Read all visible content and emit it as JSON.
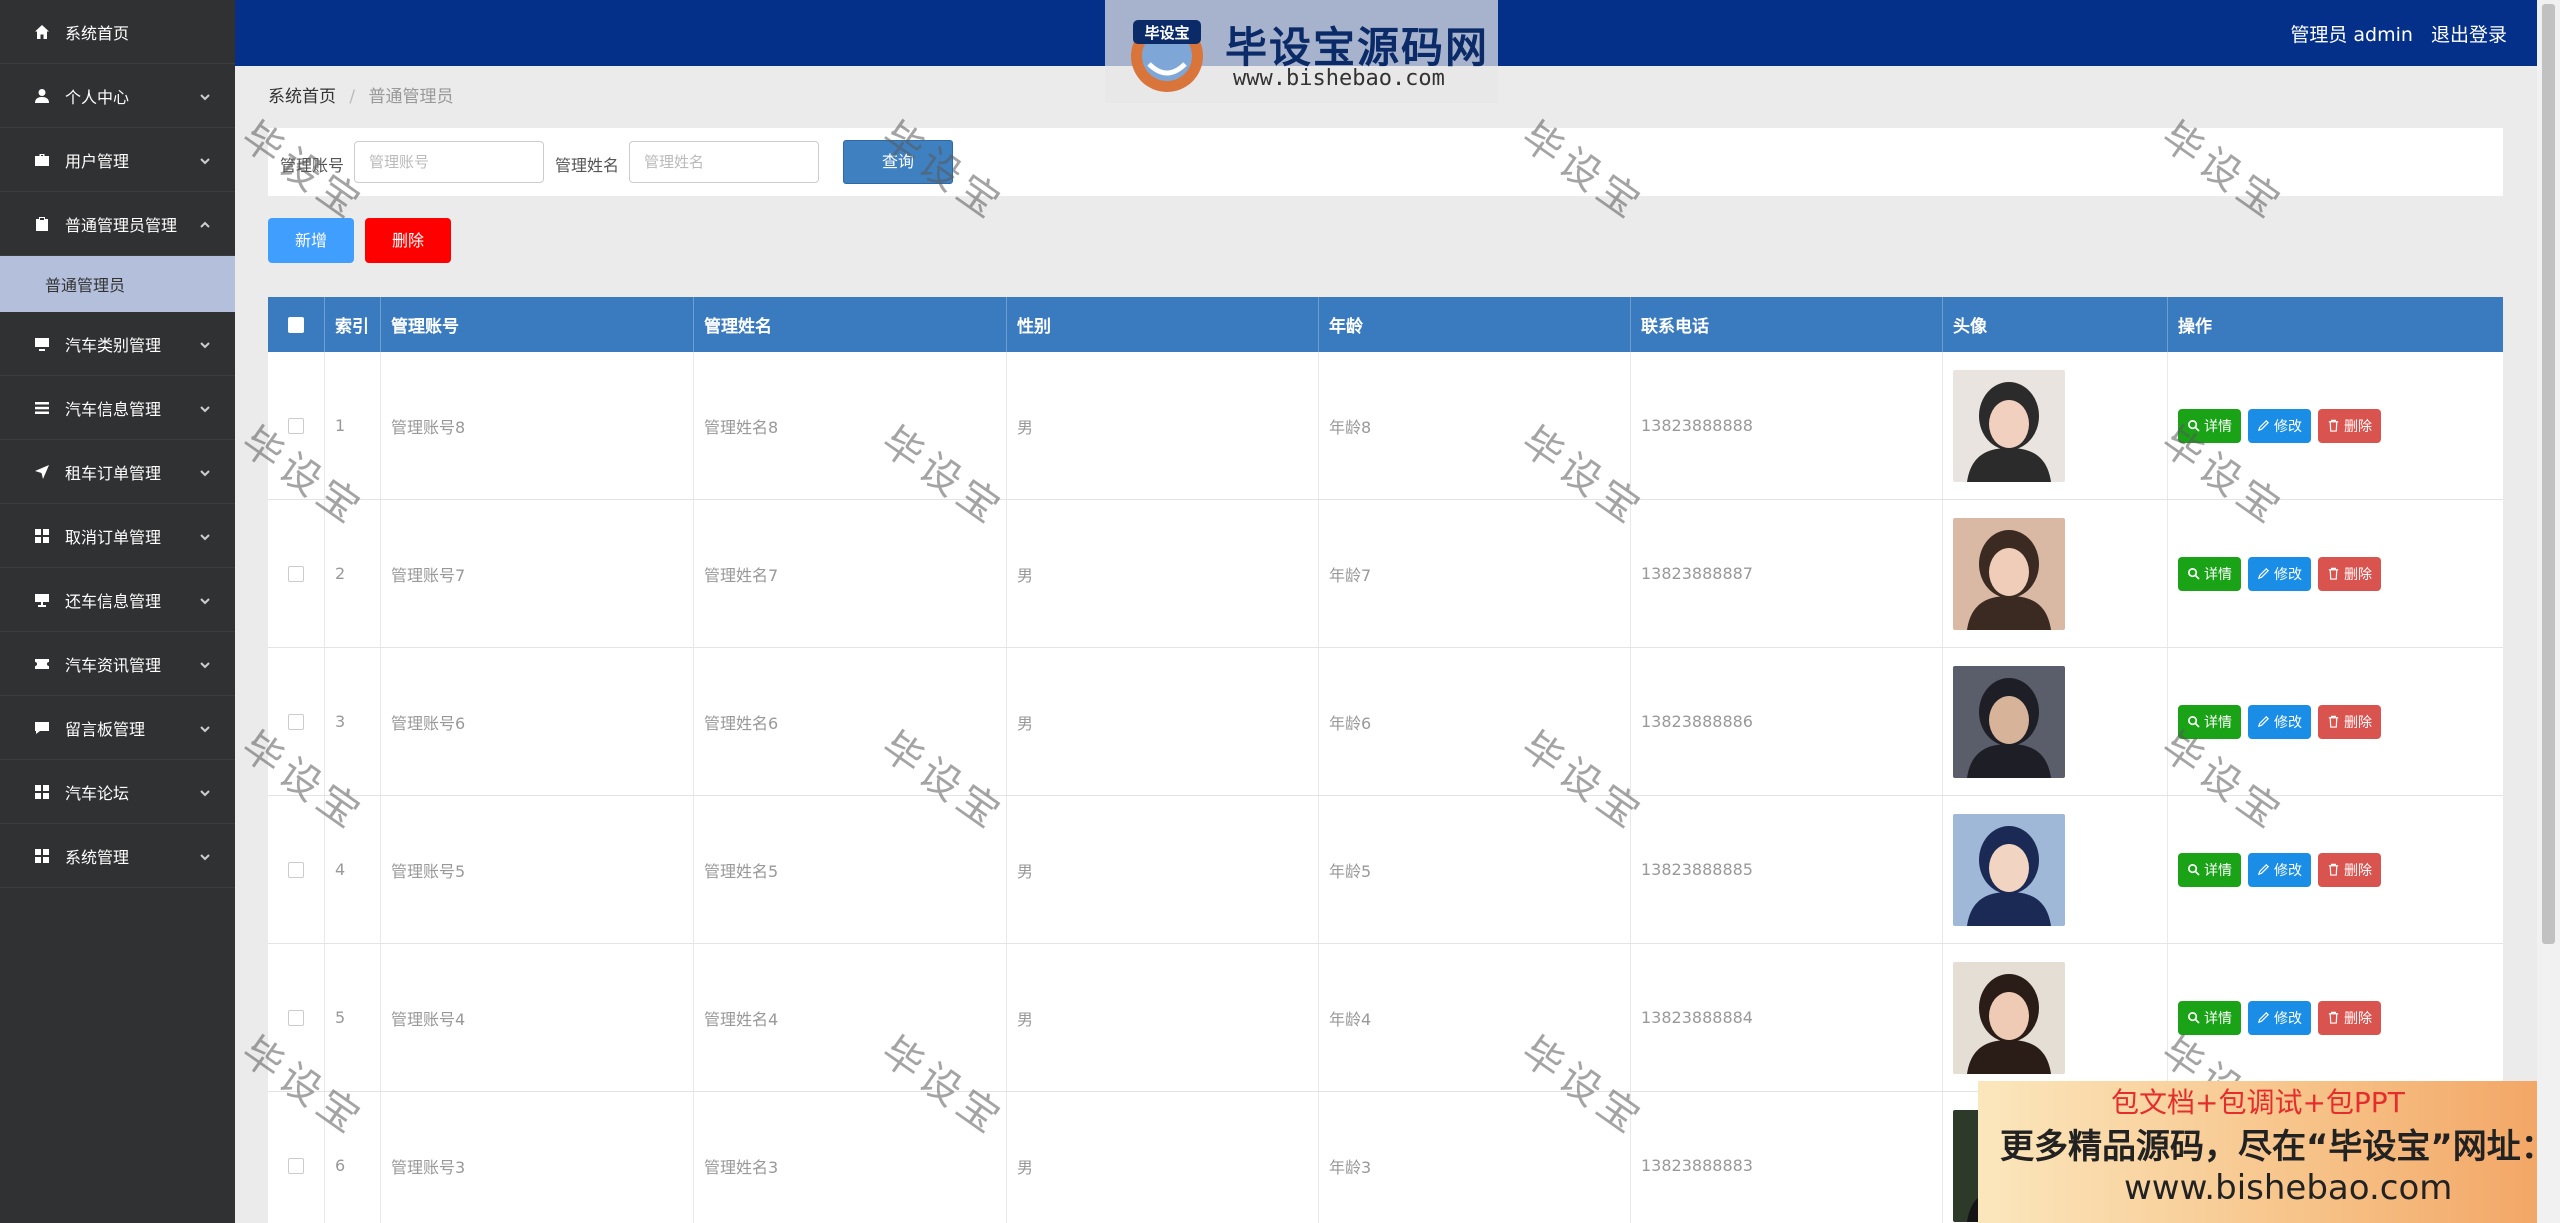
{
  "sidebar": {
    "items": [
      {
        "label": "系统首页",
        "icon": "home-icon",
        "chevron": false
      },
      {
        "label": "个人中心",
        "icon": "user-icon",
        "chevron": true
      },
      {
        "label": "用户管理",
        "icon": "briefcase-icon",
        "chevron": true
      },
      {
        "label": "普通管理员管理",
        "icon": "clipboard-icon",
        "chevron": true,
        "expanded": true
      },
      {
        "label": "汽车类别管理",
        "icon": "monitor-icon",
        "chevron": true
      },
      {
        "label": "汽车信息管理",
        "icon": "list-icon",
        "chevron": true
      },
      {
        "label": "租车订单管理",
        "icon": "send-icon",
        "chevron": true
      },
      {
        "label": "取消订单管理",
        "icon": "grid-icon",
        "chevron": true
      },
      {
        "label": "还车信息管理",
        "icon": "monitor-stand-icon",
        "chevron": true
      },
      {
        "label": "汽车资讯管理",
        "icon": "ticket-icon",
        "chevron": true
      },
      {
        "label": "留言板管理",
        "icon": "chat-icon",
        "chevron": true
      },
      {
        "label": "汽车论坛",
        "icon": "grid-icon",
        "chevron": true
      },
      {
        "label": "系统管理",
        "icon": "grid-icon",
        "chevron": true
      }
    ],
    "subitem": "普通管理员"
  },
  "header": {
    "user_label": "管理员 admin",
    "logout": "退出登录"
  },
  "brand_watermark": {
    "logo_text": "毕设宝",
    "title": "毕设宝源码网",
    "url": "www.bishebao.com"
  },
  "breadcrumb": {
    "home": "系统首页",
    "current": "普通管理员"
  },
  "search": {
    "account_label": "管理账号",
    "account_placeholder": "管理账号",
    "name_label": "管理姓名",
    "name_placeholder": "管理姓名",
    "query_button": "查询"
  },
  "actions": {
    "add": "新增",
    "delete": "删除"
  },
  "table": {
    "headers": [
      "索引",
      "管理账号",
      "管理姓名",
      "性别",
      "年龄",
      "联系电话",
      "头像",
      "操作"
    ],
    "rows": [
      {
        "index": "1",
        "account": "管理账号8",
        "name": "管理姓名8",
        "gender": "男",
        "age": "年龄8",
        "phone": "13823888888"
      },
      {
        "index": "2",
        "account": "管理账号7",
        "name": "管理姓名7",
        "gender": "男",
        "age": "年龄7",
        "phone": "13823888887"
      },
      {
        "index": "3",
        "account": "管理账号6",
        "name": "管理姓名6",
        "gender": "男",
        "age": "年龄6",
        "phone": "13823888886"
      },
      {
        "index": "4",
        "account": "管理账号5",
        "name": "管理姓名5",
        "gender": "男",
        "age": "年龄5",
        "phone": "13823888885"
      },
      {
        "index": "5",
        "account": "管理账号4",
        "name": "管理姓名4",
        "gender": "男",
        "age": "年龄4",
        "phone": "13823888884"
      },
      {
        "index": "6",
        "account": "管理账号3",
        "name": "管理姓名3",
        "gender": "男",
        "age": "年龄3",
        "phone": "13823888883"
      }
    ],
    "row_actions": {
      "detail": "详情",
      "edit": "修改",
      "delete": "删除"
    }
  },
  "watermark_text": "毕设宝",
  "promo": {
    "line1": "包文档+包调试+包PPT",
    "line2": "更多精品源码，尽在“毕设宝”网址：",
    "line3": "www.bishebao.com"
  },
  "colors": {
    "sidebar_bg": "#303133",
    "topbar_bg": "#05308a",
    "table_header": "#3a7bbf",
    "add_button": "#409eff",
    "delete_button": "#ff0000",
    "detail_button": "#1aa317",
    "edit_button": "#1a8ee6",
    "row_delete_button": "#d9534f"
  }
}
